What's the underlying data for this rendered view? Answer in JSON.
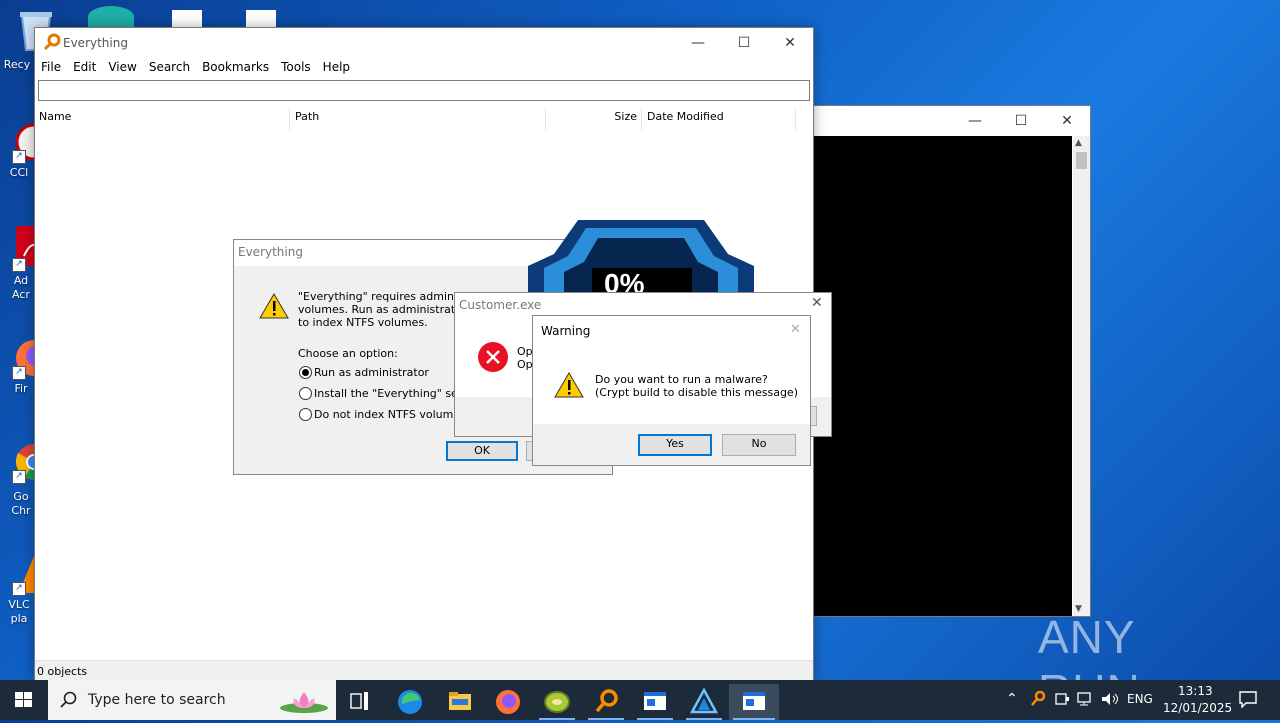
{
  "desktop": {
    "icons": [
      {
        "label": "Recy",
        "icon": "recycle-bin-icon"
      },
      {
        "label": "CCl",
        "icon": "ccleaner-icon"
      },
      {
        "label": "Ad Acr",
        "icon": "acrobat-icon"
      },
      {
        "label": "Fir",
        "icon": "firefox-icon"
      },
      {
        "label": "Go Chr",
        "icon": "chrome-icon"
      },
      {
        "label": "VLC pla",
        "icon": "vlc-icon"
      }
    ],
    "watermark": "ANY RUN"
  },
  "everything_window": {
    "title": "Everything",
    "menu": [
      "File",
      "Edit",
      "View",
      "Search",
      "Bookmarks",
      "Tools",
      "Help"
    ],
    "search_value": "",
    "columns": [
      "Name",
      "Path",
      "Size",
      "Date Modified"
    ],
    "status": "0 objects"
  },
  "everything_dialog": {
    "title": "Everything",
    "message_lines": [
      "\"Everything\" requires administrat",
      "volumes. Run as administrator or",
      "to index NTFS volumes."
    ],
    "choose_label": "Choose an option:",
    "options": [
      {
        "label": "Run as administrator",
        "selected": true
      },
      {
        "label": "Install the \"Everything\" servic",
        "selected": false
      },
      {
        "label": "Do not index NTFS volumes",
        "selected": false
      }
    ],
    "ok_label": "OK"
  },
  "ransom_badge": {
    "text": "0%"
  },
  "customer_dialog": {
    "title": "Customer.exe",
    "lines": [
      "Op",
      "Op"
    ]
  },
  "warning_dialog": {
    "title": "Warning",
    "line1": "Do you want to run a malware?",
    "line2": "(Crypt build to disable this message)",
    "yes_label": "Yes",
    "no_label": "No"
  },
  "taskbar": {
    "search_placeholder": "Type here to search",
    "language": "ENG",
    "time": "13:13",
    "date": "12/01/2025"
  }
}
